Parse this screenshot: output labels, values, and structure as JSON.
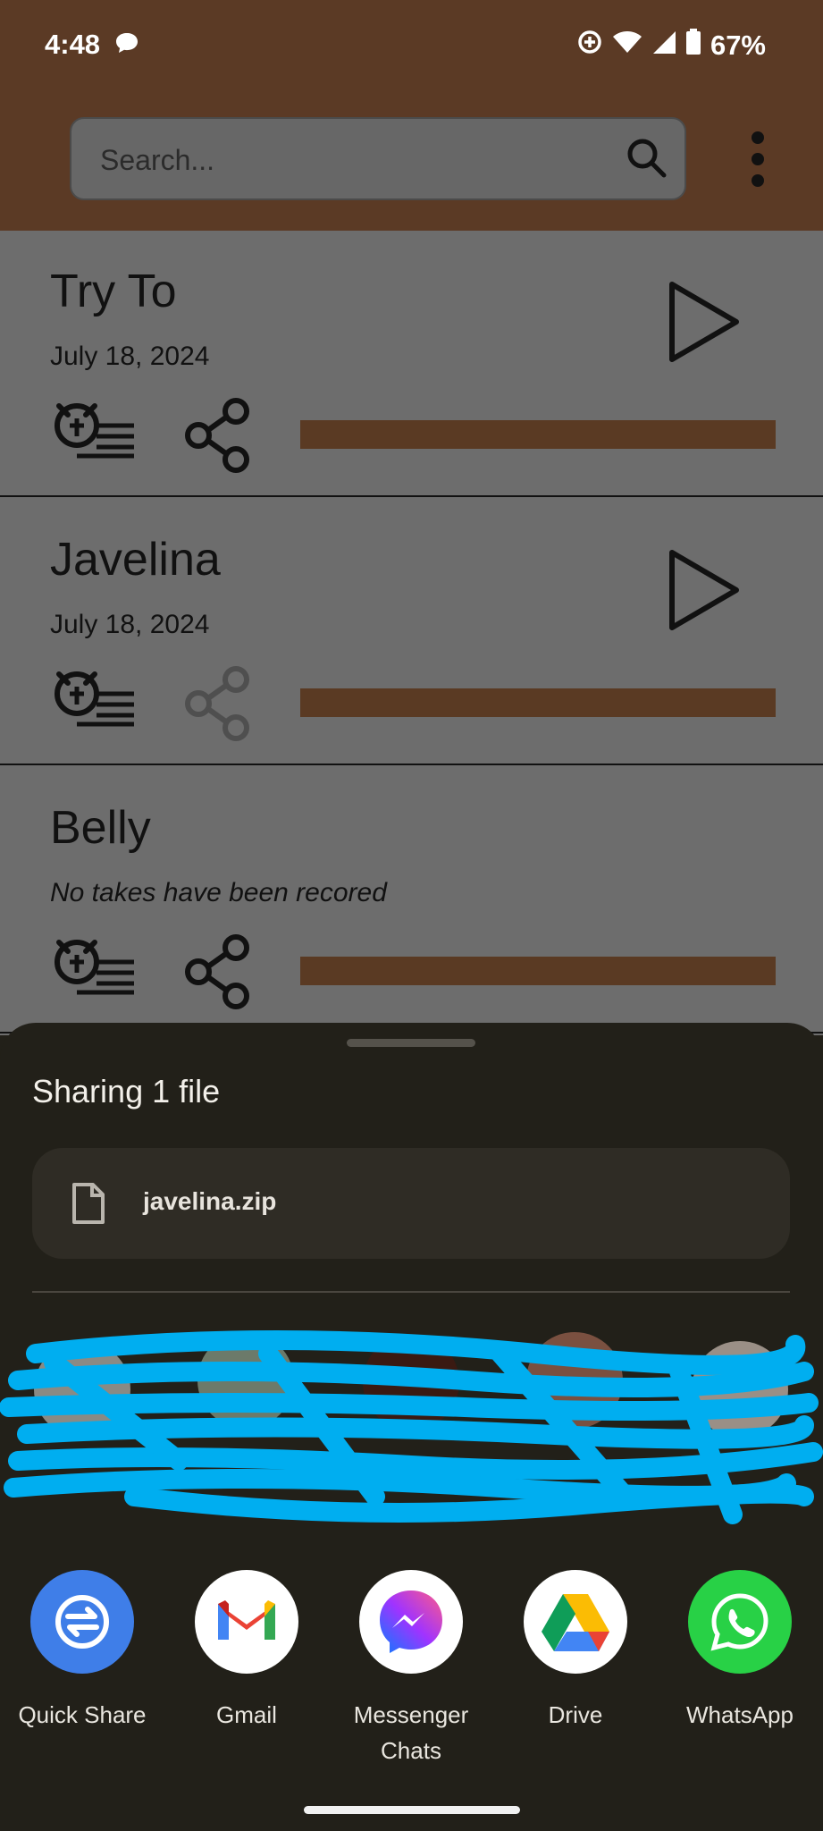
{
  "status_bar": {
    "time": "4:48",
    "battery": "67%",
    "icons": [
      "chat-bubble-icon",
      "data-saver-icon",
      "wifi-icon",
      "signal-icon",
      "battery-icon"
    ]
  },
  "app_bar": {
    "search_placeholder": "Search...",
    "colors": {
      "brand": "#5b3a25"
    }
  },
  "songs": [
    {
      "title": "Try To",
      "subtitle": "July 18, 2024",
      "share_enabled": true,
      "has_play": true
    },
    {
      "title": "Javelina",
      "subtitle": "July 18, 2024",
      "share_enabled": false,
      "has_play": true
    },
    {
      "title": "Belly",
      "subtitle": "No takes have been recored",
      "share_enabled": true,
      "has_play": false
    }
  ],
  "share_sheet": {
    "title": "Sharing 1 file",
    "file_name": "javelina.zip",
    "apps": [
      {
        "label": "Quick Share",
        "icon": "quick-share-icon"
      },
      {
        "label": "Gmail",
        "icon": "gmail-icon"
      },
      {
        "label": "Messenger",
        "label2": "Chats",
        "icon": "messenger-icon"
      },
      {
        "label": "Drive",
        "icon": "drive-icon"
      },
      {
        "label": "WhatsApp",
        "icon": "whatsapp-icon"
      }
    ]
  }
}
